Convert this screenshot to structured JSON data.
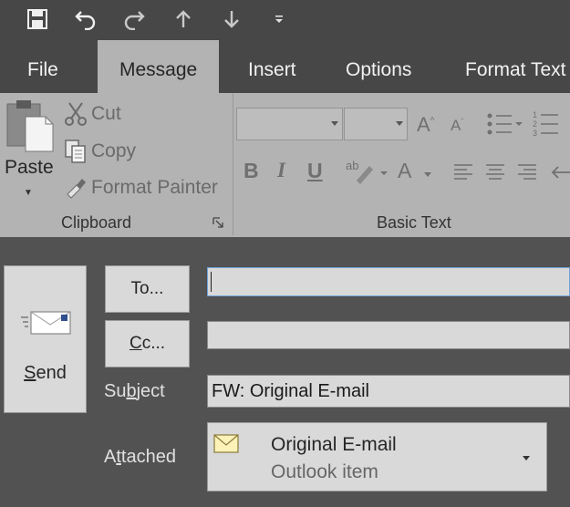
{
  "tabs": [
    {
      "label": "File"
    },
    {
      "label": "Message",
      "active": true
    },
    {
      "label": "Insert"
    },
    {
      "label": "Options"
    },
    {
      "label": "Format Text"
    }
  ],
  "clipboard": {
    "paste_label": "Paste",
    "cut_label": "Cut",
    "copy_label": "Copy",
    "format_painter_label": "Format Painter",
    "group_label": "Clipboard"
  },
  "basic_text": {
    "group_label": "Basic Text",
    "font_name": "",
    "font_size": "",
    "bold_label": "B",
    "italic_label": "I",
    "underline_label": "U",
    "font_color_label": "A",
    "grow_font_label": "A",
    "shrink_font_label": "A"
  },
  "compose": {
    "send_label_first": "S",
    "send_label_rest": "end",
    "to_label_first": "To",
    "to_label_rest": "...",
    "cc_label_first": "C",
    "cc_label_rest": "c...",
    "to_value": "",
    "cc_value": "",
    "subject_label_a": "Su",
    "subject_label_b": "b",
    "subject_label_c": "ject",
    "subject_value": "FW: Original E-mail",
    "attached_label_a": "A",
    "attached_label_b": "t",
    "attached_label_c": "tached",
    "attachment_name": "Original E-mail",
    "attachment_type": "Outlook item"
  },
  "colors": {
    "titlebar": "#474747",
    "ribbon": "#b3b3b3",
    "compose_bg": "#525252",
    "field_bg": "#d9d9d9",
    "focus_border": "#6ea3d8"
  },
  "icons": [
    "save-icon",
    "undo-icon",
    "redo-icon",
    "up-arrow-icon",
    "down-arrow-icon",
    "customize-qat-icon",
    "clipboard-icon",
    "scissors-icon",
    "copy-icon",
    "paintbrush-icon",
    "send-envelope-icon",
    "mail-item-icon"
  ]
}
